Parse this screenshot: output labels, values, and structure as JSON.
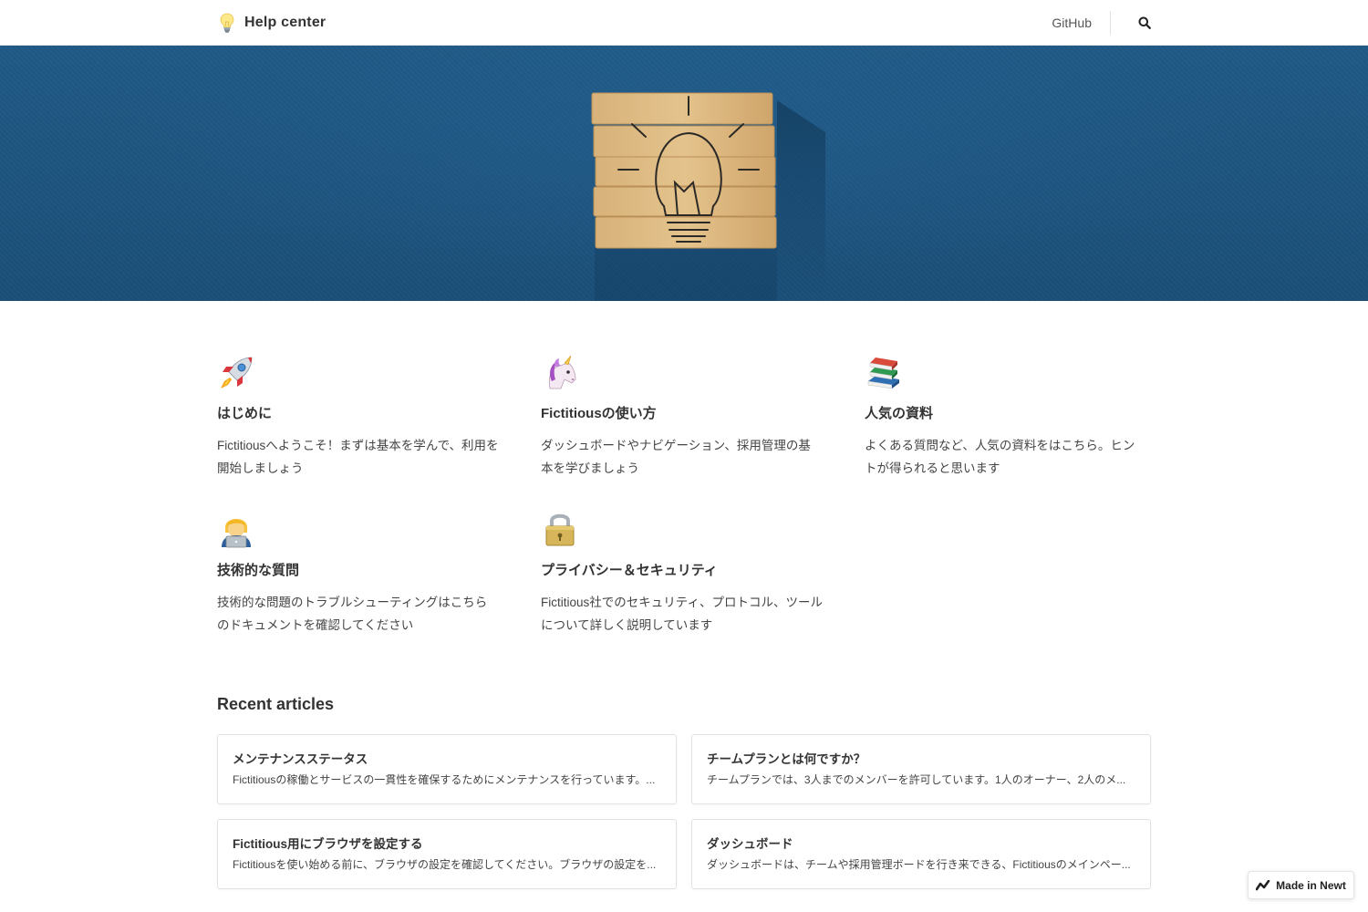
{
  "header": {
    "site_title": "Help center",
    "logo_icon": "light-bulb-icon",
    "github_label": "GitHub",
    "search_icon": "search-icon"
  },
  "hero": {
    "image": "wooden-blocks-light-bulb"
  },
  "categories": [
    {
      "icon": "rocket-icon",
      "title": "はじめに",
      "description": "Fictitiousへようこそ！まずは基本を学んで、利用を開始しましょう"
    },
    {
      "icon": "unicorn-icon",
      "title": "Fictitiousの使い方",
      "description": "ダッシュボードやナビゲーション、採用管理の基本を学びましょう"
    },
    {
      "icon": "books-icon",
      "title": "人気の資料",
      "description": "よくある質問など、人気の資料をはこちら。ヒントが得られると思います"
    },
    {
      "icon": "technologist-icon",
      "title": "技術的な質問",
      "description": "技術的な問題のトラブルシューティングはこちらのドキュメントを確認してください"
    },
    {
      "icon": "lock-icon",
      "title": "プライバシー＆セキュリティ",
      "description": "Fictitious社でのセキュリティ、プロトコル、ツールについて詳しく説明しています"
    }
  ],
  "recent": {
    "heading": "Recent articles",
    "articles": [
      {
        "title": "メンテナンスステータス",
        "excerpt": "Fictitiousの稼働とサービスの一貫性を確保するためにメンテナンスを行っています。..."
      },
      {
        "title": "チームプランとは何ですか？",
        "excerpt": "チームプランでは、3人までのメンバーを許可しています。1人のオーナー、2人のメ..."
      },
      {
        "title": "Fictitious用にブラウザを設定する",
        "excerpt": "Fictitiousを使い始める前に、ブラウザの設定を確認してください。ブラウザの設定を..."
      },
      {
        "title": "ダッシュボード",
        "excerpt": "ダッシュボードは、チームや採用管理ボードを行き来できる、Fictitiousのメインペー..."
      }
    ]
  },
  "badge": {
    "label": "Made in Newt",
    "icon": "newt-logo-icon"
  },
  "colors": {
    "hero_blue": "#1c4f78",
    "text": "#333333",
    "border": "#e2e2e2"
  }
}
